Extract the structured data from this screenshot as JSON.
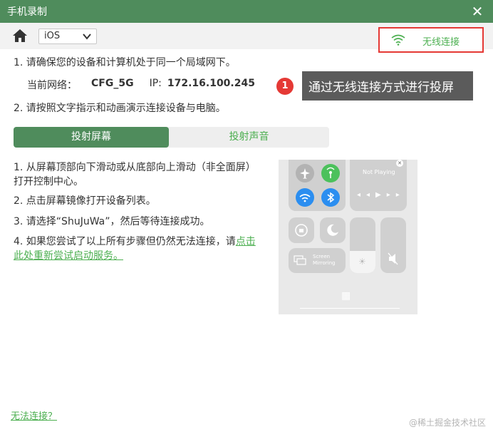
{
  "window": {
    "title": "手机录制"
  },
  "toolbar": {
    "os_selected": "iOS",
    "wireless_label": "无线连接"
  },
  "steps": {
    "step1": "1. 请确保您的设备和计算机处于同一个局域网下。",
    "network_label": "当前网络：",
    "network_value": "CFG_5G",
    "ip_label": "IP:",
    "ip_value": "172.16.100.245",
    "step2": "2. 请按照文字指示和动画演示连接设备与电脑。"
  },
  "callout": {
    "number": "1",
    "text": "通过无线连接方式进行投屏"
  },
  "tabs": [
    {
      "label": "投射屏幕",
      "active": true
    },
    {
      "label": "投射声音",
      "active": false
    }
  ],
  "instructions": {
    "i1": "1. 从屏幕顶部向下滑动或从底部向上滑动（非全面屏）打开控制中心。",
    "i2": "2. 点击屏幕镜像打开设备列表。",
    "i3": "3. 请选择“ShuJuWa”，然后等待连接成功。",
    "i4_prefix": "4. 如果您尝试了以上所有步骤但仍然无法连接，请",
    "i4_link": "点击此处重新尝试启动服务。"
  },
  "phone": {
    "now_playing": "Not Playing",
    "screen_mirroring": "Screen\nMirroring"
  },
  "footer": {
    "cannot_connect": "无法连接？"
  },
  "watermark": "@稀土掘金技术社区",
  "colors": {
    "brand_green": "#4f8c5c",
    "accent_green": "#4caf50",
    "highlight_red": "#e53935"
  }
}
